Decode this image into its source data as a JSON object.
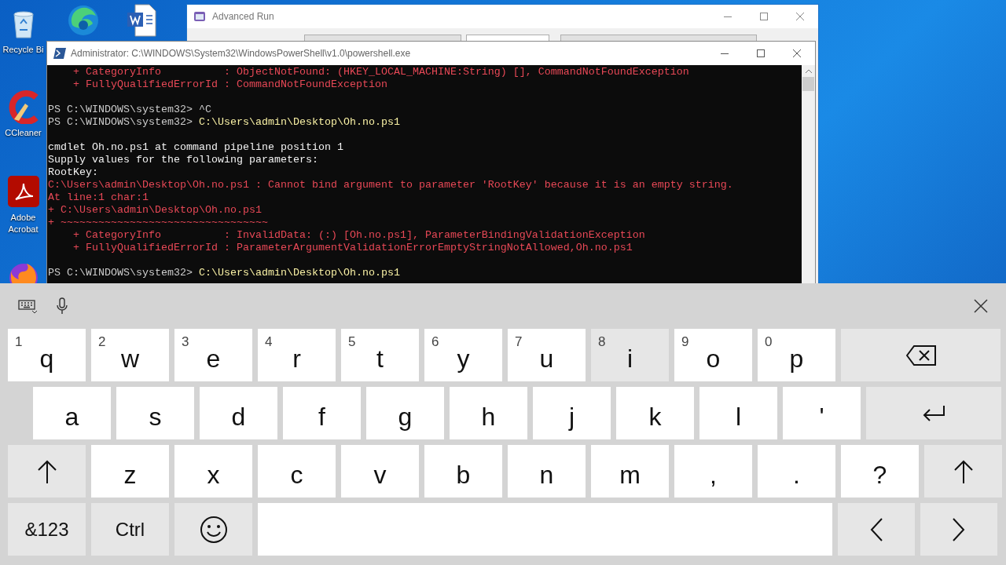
{
  "desktop_icons": [
    {
      "kind": "recycle",
      "label": "Recycle Bi"
    },
    {
      "kind": "edge"
    },
    {
      "kind": "word"
    },
    {
      "kind": "ccleaner",
      "label": "CCleaner"
    },
    {
      "kind": "acrobat",
      "label": "Adobe Acrobat"
    },
    {
      "kind": "firefox"
    }
  ],
  "advanced_run": {
    "title": "Advanced Run"
  },
  "terminal": {
    "title": "Administrator: C:\\WINDOWS\\System32\\WindowsPowerShell\\v1.0\\powershell.exe",
    "lines": [
      {
        "kind": "error",
        "text": "    + CategoryInfo          : ObjectNotFound: (HKEY_LOCAL_MACHINE:String) [], CommandNotFoundException"
      },
      {
        "kind": "error",
        "text": "    + FullyQualifiedErrorId : CommandNotFoundException"
      },
      {
        "kind": "blank"
      },
      {
        "kind": "prompt",
        "prompt": "PS C:\\WINDOWS\\system32>",
        "text": "^C",
        "typed": false
      },
      {
        "kind": "prompt",
        "prompt": "PS C:\\WINDOWS\\system32>",
        "text": "C:\\Users\\admin\\Desktop\\Oh.no.ps1",
        "typed": true
      },
      {
        "kind": "blank"
      },
      {
        "kind": "output",
        "text": "cmdlet Oh.no.ps1 at command pipeline position 1"
      },
      {
        "kind": "output",
        "text": "Supply values for the following parameters:"
      },
      {
        "kind": "output",
        "text": "RootKey:"
      },
      {
        "kind": "error",
        "text": "C:\\Users\\admin\\Desktop\\Oh.no.ps1 : Cannot bind argument to parameter 'RootKey' because it is an empty string."
      },
      {
        "kind": "error",
        "text": "At line:1 char:1"
      },
      {
        "kind": "error",
        "text": "+ C:\\Users\\admin\\Desktop\\Oh.no.ps1"
      },
      {
        "kind": "error",
        "text": "+ ~~~~~~~~~~~~~~~~~~~~~~~~~~~~~~~~~"
      },
      {
        "kind": "error",
        "text": "    + CategoryInfo          : InvalidData: (:) [Oh.no.ps1], ParameterBindingValidationException"
      },
      {
        "kind": "error",
        "text": "    + FullyQualifiedErrorId : ParameterArgumentValidationErrorEmptyStringNotAllowed,Oh.no.ps1"
      },
      {
        "kind": "blank"
      },
      {
        "kind": "prompt",
        "prompt": "PS C:\\WINDOWS\\system32>",
        "text": "C:\\Users\\admin\\Desktop\\Oh.no.ps1",
        "typed": true
      }
    ]
  },
  "keyboard": {
    "rows": [
      [
        {
          "kind": "char",
          "label": "q",
          "hint": "1",
          "highlighted": false
        },
        {
          "kind": "char",
          "label": "w",
          "hint": "2",
          "highlighted": false
        },
        {
          "kind": "char",
          "label": "e",
          "hint": "3",
          "highlighted": false
        },
        {
          "kind": "char",
          "label": "r",
          "hint": "4",
          "highlighted": false
        },
        {
          "kind": "char",
          "label": "t",
          "hint": "5",
          "highlighted": false
        },
        {
          "kind": "char",
          "label": "y",
          "hint": "6",
          "highlighted": false
        },
        {
          "kind": "char",
          "label": "u",
          "hint": "7",
          "highlighted": false
        },
        {
          "kind": "char",
          "label": "i",
          "hint": "8",
          "highlighted": true
        },
        {
          "kind": "char",
          "label": "o",
          "hint": "9",
          "highlighted": false
        },
        {
          "kind": "char",
          "label": "p",
          "hint": "0",
          "highlighted": false
        },
        {
          "kind": "backspace"
        }
      ],
      [
        {
          "kind": "char",
          "label": "a",
          "highlighted": false
        },
        {
          "kind": "char",
          "label": "s",
          "highlighted": false
        },
        {
          "kind": "char",
          "label": "d",
          "highlighted": false
        },
        {
          "kind": "char",
          "label": "f",
          "highlighted": false
        },
        {
          "kind": "char",
          "label": "g",
          "highlighted": false
        },
        {
          "kind": "char",
          "label": "h",
          "highlighted": false
        },
        {
          "kind": "char",
          "label": "j",
          "highlighted": false
        },
        {
          "kind": "char",
          "label": "k",
          "highlighted": false
        },
        {
          "kind": "char",
          "label": "l",
          "highlighted": false
        },
        {
          "kind": "char",
          "label": "'",
          "highlighted": false
        },
        {
          "kind": "enter"
        }
      ],
      [
        {
          "kind": "shift"
        },
        {
          "kind": "char",
          "label": "z",
          "highlighted": false
        },
        {
          "kind": "char",
          "label": "x",
          "highlighted": false
        },
        {
          "kind": "char",
          "label": "c",
          "highlighted": false
        },
        {
          "kind": "char",
          "label": "v",
          "highlighted": false
        },
        {
          "kind": "char",
          "label": "b",
          "highlighted": false
        },
        {
          "kind": "char",
          "label": "n",
          "highlighted": false
        },
        {
          "kind": "char",
          "label": "m",
          "highlighted": false
        },
        {
          "kind": "char",
          "label": ",",
          "highlighted": false
        },
        {
          "kind": "char",
          "label": ".",
          "highlighted": false
        },
        {
          "kind": "char",
          "label": "?",
          "highlighted": false
        },
        {
          "kind": "shift"
        }
      ],
      [
        {
          "kind": "text",
          "label": "&123"
        },
        {
          "kind": "text",
          "label": "Ctrl"
        },
        {
          "kind": "emoji"
        },
        {
          "kind": "space"
        },
        {
          "kind": "left"
        },
        {
          "kind": "right"
        }
      ]
    ]
  }
}
